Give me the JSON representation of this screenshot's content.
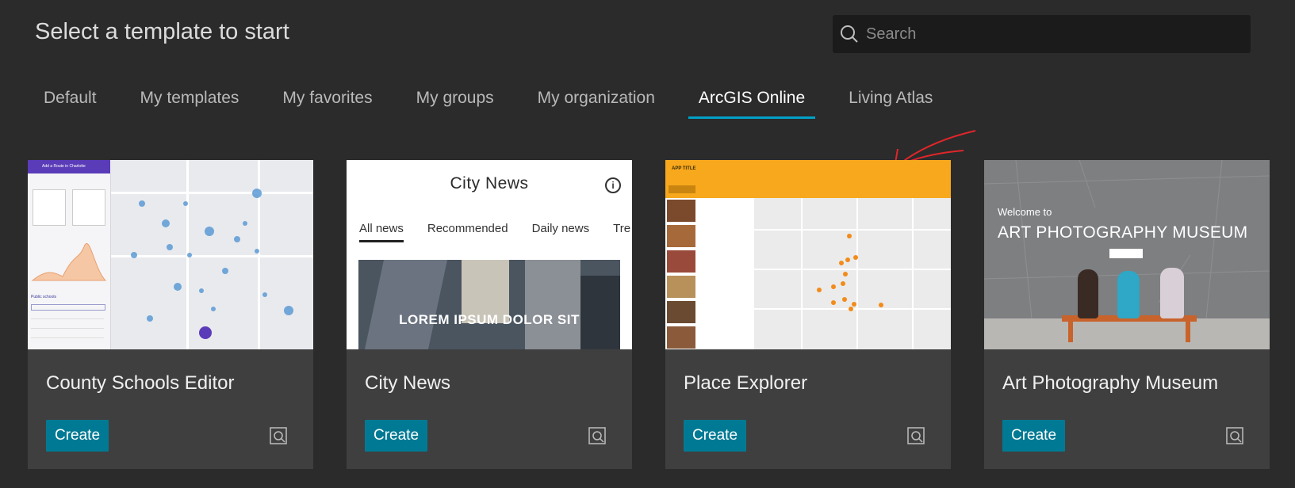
{
  "header": {
    "title": "Select a template to start",
    "search_placeholder": "Search",
    "search_icon": "search-icon"
  },
  "tabs": [
    {
      "label": "Default",
      "active": false
    },
    {
      "label": "My templates",
      "active": false
    },
    {
      "label": "My favorites",
      "active": false
    },
    {
      "label": "My groups",
      "active": false
    },
    {
      "label": "My organization",
      "active": false
    },
    {
      "label": "ArcGIS Online",
      "active": true
    },
    {
      "label": "Living Atlas",
      "active": false
    }
  ],
  "cards": [
    {
      "title": "County Schools Editor",
      "create_label": "Create",
      "preview_icon": "preview-icon",
      "thumb": {
        "header": "Add a Route in Charlotte",
        "section": "Public schools"
      }
    },
    {
      "title": "City News",
      "create_label": "Create",
      "preview_icon": "preview-icon",
      "thumb": {
        "heading": "City News",
        "tabs": [
          "All news",
          "Recommended",
          "Daily news",
          "Tre"
        ],
        "overlay": "LOREM IPSUM DOLOR SIT"
      }
    },
    {
      "title": "Place Explorer",
      "create_label": "Create",
      "preview_icon": "preview-icon",
      "thumb": {
        "app_title": "APP TITLE"
      }
    },
    {
      "title": "Art Photography Museum",
      "create_label": "Create",
      "preview_icon": "preview-icon",
      "thumb": {
        "welcome": "Welcome to",
        "heading": "ART PHOTOGRAPHY MUSEUM"
      }
    }
  ],
  "colors": {
    "background": "#2b2b2b",
    "card": "#3f3f3f",
    "accent": "#00a0c6",
    "button": "#007a94",
    "annotation": "#e0262a"
  }
}
